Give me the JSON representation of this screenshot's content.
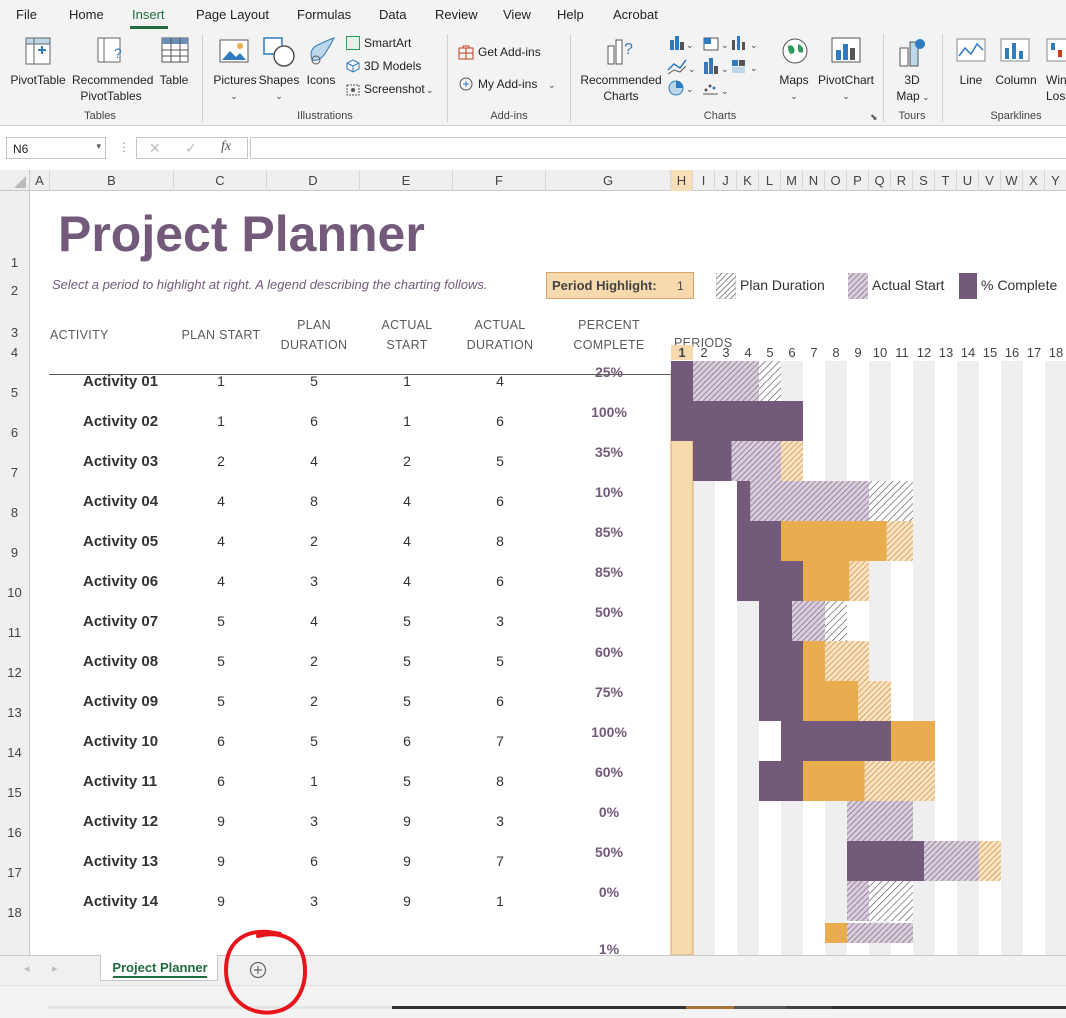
{
  "menu": [
    "File",
    "Home",
    "Insert",
    "Page Layout",
    "Formulas",
    "Data",
    "Review",
    "View",
    "Help",
    "Acrobat"
  ],
  "ribbon": {
    "groups": {
      "tables": "Tables",
      "illustrations": "Illustrations",
      "addins": "Add-ins",
      "charts": "Charts",
      "tours": "Tours",
      "sparklines": "Sparklines"
    },
    "pivottable": "PivotTable",
    "recommended_pivot": [
      "Recommended",
      "PivotTables"
    ],
    "table": "Table",
    "pictures": "Pictures",
    "shapes": "Shapes",
    "icons": "Icons",
    "smartart": "SmartArt",
    "models3d": "3D Models",
    "screenshot": "Screenshot",
    "get_addins": "Get Add-ins",
    "my_addins": "My Add-ins",
    "recommended_charts": [
      "Recommended",
      "Charts"
    ],
    "maps": "Maps",
    "pivotchart": "PivotChart",
    "map3d": [
      "3D",
      "Map"
    ],
    "line": "Line",
    "column": "Column",
    "winloss": [
      "Win/",
      "Loss"
    ]
  },
  "namebox": "N6",
  "fx": "fx",
  "columns": [
    "A",
    "B",
    "C",
    "D",
    "E",
    "F",
    "G",
    "H",
    "I",
    "J",
    "K",
    "L",
    "M",
    "N",
    "O",
    "P",
    "Q",
    "R",
    "S",
    "T",
    "U",
    "V",
    "W",
    "X",
    "Y"
  ],
  "rows": [
    "1",
    "2",
    "3",
    "4",
    "5",
    "6",
    "7",
    "8",
    "9",
    "10",
    "11",
    "12",
    "13",
    "14",
    "15",
    "16",
    "17",
    "18"
  ],
  "sheet": {
    "title": "Project Planner",
    "subtitle": "Select a period to highlight at right.  A legend describing the charting follows.",
    "period_highlight_label": "Period Highlight:",
    "period_highlight_value": "1",
    "legend": {
      "plan": "Plan Duration",
      "actual": "Actual Start",
      "complete": "% Complete"
    },
    "headers": {
      "activity": "ACTIVITY",
      "plan_start": "PLAN START",
      "plan_duration": [
        "PLAN",
        "DURATION"
      ],
      "actual_start": [
        "ACTUAL",
        "START"
      ],
      "actual_duration": [
        "ACTUAL",
        "DURATION"
      ],
      "percent_complete": [
        "PERCENT",
        "COMPLETE"
      ],
      "periods": "PERIODS"
    },
    "periods": [
      "1",
      "2",
      "3",
      "4",
      "5",
      "6",
      "7",
      "8",
      "9",
      "10",
      "11",
      "12",
      "13",
      "14",
      "15",
      "16",
      "17",
      "18"
    ],
    "activities": [
      {
        "name": "Activity 01",
        "plan_start": 1,
        "plan_duration": 5,
        "actual_start": 1,
        "actual_duration": 4,
        "percent": "25%"
      },
      {
        "name": "Activity 02",
        "plan_start": 1,
        "plan_duration": 6,
        "actual_start": 1,
        "actual_duration": 6,
        "percent": "100%"
      },
      {
        "name": "Activity 03",
        "plan_start": 2,
        "plan_duration": 4,
        "actual_start": 2,
        "actual_duration": 5,
        "percent": "35%"
      },
      {
        "name": "Activity 04",
        "plan_start": 4,
        "plan_duration": 8,
        "actual_start": 4,
        "actual_duration": 6,
        "percent": "10%"
      },
      {
        "name": "Activity 05",
        "plan_start": 4,
        "plan_duration": 2,
        "actual_start": 4,
        "actual_duration": 8,
        "percent": "85%"
      },
      {
        "name": "Activity 06",
        "plan_start": 4,
        "plan_duration": 3,
        "actual_start": 4,
        "actual_duration": 6,
        "percent": "85%"
      },
      {
        "name": "Activity 07",
        "plan_start": 5,
        "plan_duration": 4,
        "actual_start": 5,
        "actual_duration": 3,
        "percent": "50%"
      },
      {
        "name": "Activity 08",
        "plan_start": 5,
        "plan_duration": 2,
        "actual_start": 5,
        "actual_duration": 5,
        "percent": "60%"
      },
      {
        "name": "Activity 09",
        "plan_start": 5,
        "plan_duration": 2,
        "actual_start": 5,
        "actual_duration": 6,
        "percent": "75%"
      },
      {
        "name": "Activity 10",
        "plan_start": 6,
        "plan_duration": 5,
        "actual_start": 6,
        "actual_duration": 7,
        "percent": "100%"
      },
      {
        "name": "Activity 11",
        "plan_start": 6,
        "plan_duration": 1,
        "actual_start": 5,
        "actual_duration": 8,
        "percent": "60%"
      },
      {
        "name": "Activity 12",
        "plan_start": 9,
        "plan_duration": 3,
        "actual_start": 9,
        "actual_duration": 3,
        "percent": "0%"
      },
      {
        "name": "Activity 13",
        "plan_start": 9,
        "plan_duration": 6,
        "actual_start": 9,
        "actual_duration": 7,
        "percent": "50%"
      },
      {
        "name": "Activity 14",
        "plan_start": 9,
        "plan_duration": 3,
        "actual_start": 9,
        "actual_duration": 1,
        "percent": "0%"
      }
    ],
    "partial_row_percent": "1%"
  },
  "tab_name": "Project Planner",
  "colors": {
    "accent_green": "#1e6c3f",
    "title_purple": "#735a7a",
    "bar_purple": "#735a7a",
    "bar_orange": "#e9ac4f",
    "highlight": "#f6d9ac",
    "annotation_red": "#e8141c"
  }
}
